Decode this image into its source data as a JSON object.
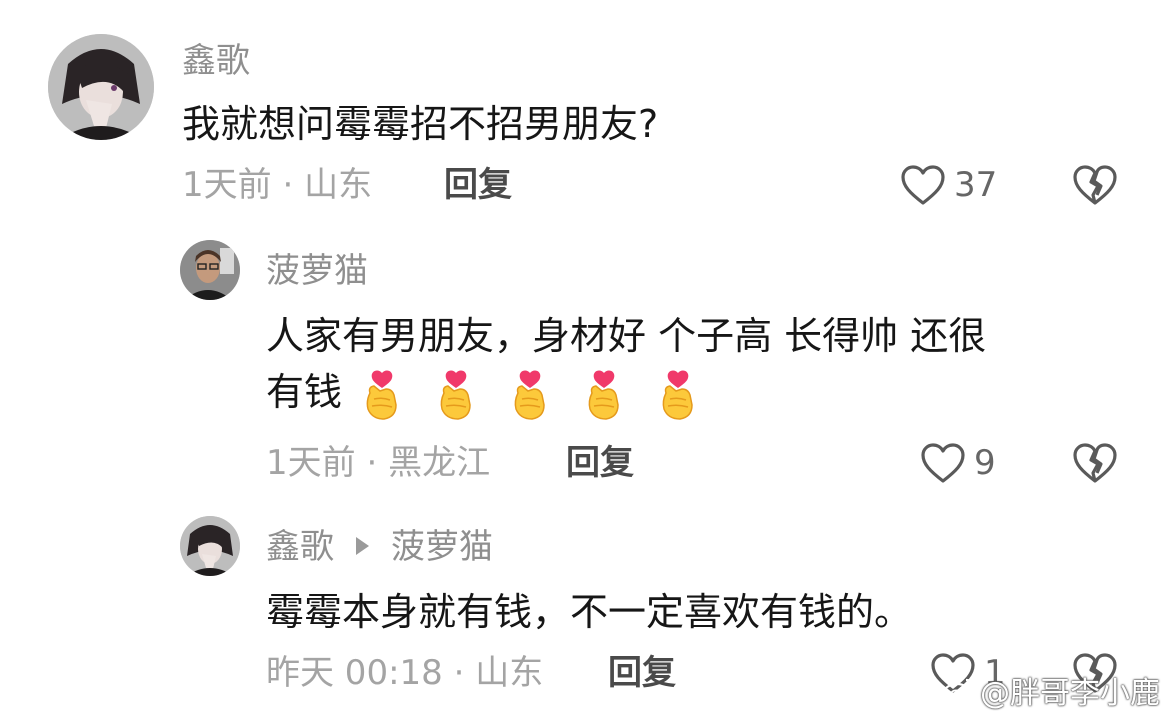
{
  "comments": [
    {
      "username": "鑫歌",
      "text": "我就想问霉霉招不招男朋友?",
      "time": "1天前",
      "location": "山东",
      "reply_label": "回复",
      "likes": "37"
    },
    {
      "username": "菠萝猫",
      "text_line1": "人家有男朋友，身材好 个子高 长得帅 还很",
      "text_line2": "有钱",
      "emojis": [
        "finger-heart",
        "finger-heart",
        "finger-heart",
        "finger-heart",
        "finger-heart"
      ],
      "time": "1天前",
      "location": "黑龙江",
      "reply_label": "回复",
      "likes": "9"
    },
    {
      "username": "鑫歌",
      "reply_to": "菠萝猫",
      "text": "霉霉本身就有钱，不一定喜欢有钱的。",
      "time": "昨天 00:18",
      "location": "山东",
      "reply_label": "回复",
      "likes": "1"
    }
  ],
  "separator": "·",
  "icons": {
    "like": "heart-outline-icon",
    "dislike": "broken-heart-icon"
  },
  "watermark": "@胖哥李小鹿",
  "colors": {
    "username": "#8f8f8f",
    "meta": "#a4a4a4",
    "text": "#161616"
  }
}
